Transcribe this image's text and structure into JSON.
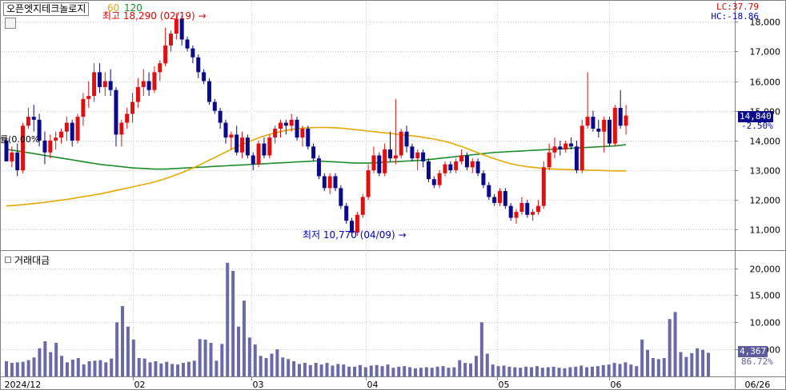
{
  "title": "오픈엣지테크놀로지",
  "ma": {
    "ma60_label": "60",
    "ma120_label": "120",
    "ma60_color": "#e6a800",
    "ma120_color": "#1a8c2a"
  },
  "indicator": {
    "lc": "LC:37.79",
    "hc": "HC:-18.86"
  },
  "left_clip": "률(0.00%",
  "annotations": {
    "high": {
      "text": "최고 18,290 (02/19)",
      "color": "#e00000"
    },
    "low": {
      "text": "최저 10,770 (04/09)",
      "color": "#0000c0"
    }
  },
  "volume_title": "거래대금",
  "current": {
    "price": "14,840",
    "change": "-2.50%",
    "volume": "4,367",
    "volume_pct": "86.72%"
  },
  "colors": {
    "up": "#e01010",
    "down": "#0a0a8a",
    "volume": "#6a6aa8",
    "grid": "#c8c8c8"
  },
  "chart_data": [
    {
      "type": "candlestick",
      "title": "오픈엣지테크놀로지",
      "x_tick_labels": [
        "2024/12",
        "02",
        "03",
        "04",
        "05",
        "06",
        "06/26"
      ],
      "y_tick_labels": [
        "18,000",
        "17,000",
        "16,000",
        "15,000",
        "14,000",
        "13,000",
        "12,000",
        "11,000"
      ],
      "ylim": [
        10500,
        18300
      ],
      "series_names": [
        "60",
        "120"
      ],
      "candles_ohlc": [
        [
          14000,
          14100,
          13300,
          13300
        ],
        [
          13300,
          13800,
          13100,
          13600
        ],
        [
          13600,
          13900,
          12800,
          13000
        ],
        [
          13000,
          14600,
          12900,
          14500
        ],
        [
          14500,
          15100,
          14400,
          14800
        ],
        [
          14800,
          15200,
          14300,
          14700
        ],
        [
          14700,
          14900,
          13800,
          14000
        ],
        [
          14000,
          14300,
          13200,
          13600
        ],
        [
          13600,
          14200,
          13400,
          14000
        ],
        [
          14000,
          14300,
          13700,
          14100
        ],
        [
          14100,
          14400,
          13900,
          14300
        ],
        [
          14300,
          14800,
          14000,
          14600
        ],
        [
          14600,
          14700,
          13800,
          14000
        ],
        [
          14000,
          14900,
          13900,
          14800
        ],
        [
          14800,
          15600,
          14500,
          15400
        ],
        [
          15400,
          16000,
          15100,
          15500
        ],
        [
          15500,
          16600,
          15300,
          16300
        ],
        [
          16300,
          16600,
          15600,
          15800
        ],
        [
          15800,
          16300,
          15500,
          16000
        ],
        [
          16000,
          16400,
          15500,
          15700
        ],
        [
          15700,
          15800,
          13800,
          14200
        ],
        [
          14200,
          14700,
          13800,
          14600
        ],
        [
          14600,
          15100,
          14400,
          14900
        ],
        [
          14900,
          15600,
          14600,
          15300
        ],
        [
          15300,
          16100,
          15100,
          15800
        ],
        [
          15800,
          16400,
          15500,
          16000
        ],
        [
          16000,
          16300,
          15500,
          15700
        ],
        [
          15700,
          16500,
          15600,
          16300
        ],
        [
          16300,
          16700,
          16000,
          16600
        ],
        [
          16600,
          17800,
          16500,
          17200
        ],
        [
          17200,
          17700,
          17000,
          17600
        ],
        [
          17600,
          18290,
          17400,
          18100
        ],
        [
          18100,
          18200,
          17200,
          17400
        ],
        [
          17400,
          17500,
          17000,
          17100
        ],
        [
          17100,
          17200,
          16600,
          16800
        ],
        [
          16800,
          16900,
          16100,
          16300
        ],
        [
          16300,
          16400,
          15900,
          16000
        ],
        [
          16000,
          16100,
          15200,
          15300
        ],
        [
          15300,
          15400,
          14900,
          15000
        ],
        [
          15000,
          15100,
          14400,
          14600
        ],
        [
          14600,
          14700,
          13900,
          14100
        ],
        [
          14100,
          14300,
          13700,
          14200
        ],
        [
          14200,
          14500,
          13500,
          13600
        ],
        [
          13600,
          14300,
          13400,
          14100
        ],
        [
          14100,
          14200,
          13400,
          13500
        ],
        [
          13500,
          13600,
          13000,
          13200
        ],
        [
          13200,
          14000,
          13100,
          13900
        ],
        [
          13900,
          14100,
          13400,
          13500
        ],
        [
          13500,
          14200,
          13400,
          14100
        ],
        [
          14100,
          14500,
          13900,
          14400
        ],
        [
          14400,
          14700,
          14100,
          14600
        ],
        [
          14600,
          14700,
          14200,
          14500
        ],
        [
          14500,
          14900,
          14300,
          14700
        ],
        [
          14700,
          14800,
          14000,
          14100
        ],
        [
          14100,
          14500,
          13800,
          14400
        ],
        [
          14400,
          14500,
          13700,
          13800
        ],
        [
          13800,
          13900,
          13300,
          13400
        ],
        [
          13400,
          13500,
          12700,
          12800
        ],
        [
          12800,
          12900,
          12300,
          12400
        ],
        [
          12400,
          12900,
          12200,
          12800
        ],
        [
          12800,
          12900,
          12300,
          12400
        ],
        [
          12400,
          12500,
          11700,
          11800
        ],
        [
          11800,
          11900,
          11200,
          11300
        ],
        [
          11300,
          11400,
          10770,
          10900
        ],
        [
          10900,
          11600,
          10800,
          11500
        ],
        [
          11500,
          12200,
          11400,
          12100
        ],
        [
          12100,
          13200,
          12000,
          13000
        ],
        [
          13000,
          13800,
          12900,
          13500
        ],
        [
          13500,
          13600,
          12800,
          12900
        ],
        [
          12900,
          13900,
          12800,
          13700
        ],
        [
          13700,
          14300,
          13300,
          13400
        ],
        [
          13400,
          15400,
          13200,
          13500
        ],
        [
          13500,
          14400,
          13400,
          14300
        ],
        [
          14300,
          14500,
          13600,
          13800
        ],
        [
          13800,
          13900,
          13300,
          13400
        ],
        [
          13400,
          13700,
          13000,
          13600
        ],
        [
          13600,
          13700,
          13100,
          13300
        ],
        [
          13300,
          13400,
          12600,
          12700
        ],
        [
          12700,
          12800,
          12400,
          12500
        ],
        [
          12500,
          13000,
          12400,
          12900
        ],
        [
          12900,
          13300,
          12800,
          13200
        ],
        [
          13200,
          13300,
          12900,
          13000
        ],
        [
          13000,
          13400,
          12900,
          13300
        ],
        [
          13300,
          13700,
          13200,
          13500
        ],
        [
          13500,
          13600,
          13000,
          13100
        ],
        [
          13100,
          13400,
          12900,
          13300
        ],
        [
          13300,
          13400,
          12800,
          12900
        ],
        [
          12900,
          13000,
          12400,
          12500
        ],
        [
          12500,
          12600,
          12000,
          12100
        ],
        [
          12100,
          12200,
          11800,
          11900
        ],
        [
          11900,
          12400,
          11800,
          12300
        ],
        [
          12300,
          12400,
          11700,
          11800
        ],
        [
          11800,
          11900,
          11300,
          11400
        ],
        [
          11400,
          11700,
          11200,
          11600
        ],
        [
          11600,
          12100,
          11500,
          11900
        ],
        [
          11900,
          12000,
          11400,
          11500
        ],
        [
          11500,
          11700,
          11300,
          11600
        ],
        [
          11600,
          12000,
          11500,
          11800
        ],
        [
          11800,
          13300,
          11700,
          13100
        ],
        [
          13100,
          13900,
          13000,
          13600
        ],
        [
          13600,
          14100,
          13400,
          13800
        ],
        [
          13800,
          14000,
          13500,
          13700
        ],
        [
          13700,
          14000,
          13600,
          13900
        ],
        [
          13900,
          14100,
          13700,
          13800
        ],
        [
          13800,
          14000,
          12900,
          13000
        ],
        [
          13000,
          14700,
          12900,
          14500
        ],
        [
          14500,
          16300,
          14400,
          14800
        ],
        [
          14800,
          15000,
          14300,
          14400
        ],
        [
          14400,
          14700,
          14100,
          14300
        ],
        [
          14300,
          14800,
          13600,
          14700
        ],
        [
          14700,
          14800,
          13800,
          13900
        ],
        [
          13900,
          15200,
          13800,
          15100
        ],
        [
          15100,
          15700,
          14400,
          14500
        ],
        [
          14500,
          15200,
          14200,
          14840
        ]
      ],
      "ma60_values": [
        11800,
        11810,
        11825,
        11840,
        11860,
        11880,
        11900,
        11920,
        11945,
        11970,
        11995,
        12020,
        12050,
        12080,
        12110,
        12140,
        12170,
        12200,
        12240,
        12280,
        12320,
        12360,
        12400,
        12440,
        12480,
        12520,
        12560,
        12610,
        12660,
        12720,
        12780,
        12850,
        12920,
        13000,
        13080,
        13160,
        13250,
        13340,
        13430,
        13520,
        13610,
        13700,
        13790,
        13870,
        13950,
        14020,
        14090,
        14150,
        14210,
        14260,
        14300,
        14340,
        14370,
        14400,
        14420,
        14430,
        14435,
        14440,
        14440,
        14435,
        14430,
        14420,
        14400,
        14380,
        14360,
        14340,
        14320,
        14300,
        14280,
        14260,
        14240,
        14220,
        14200,
        14180,
        14160,
        14140,
        14110,
        14080,
        14050,
        14010,
        13970,
        13920,
        13860,
        13800,
        13730,
        13660,
        13590,
        13520,
        13450,
        13390,
        13330,
        13270,
        13220,
        13180,
        13150,
        13120,
        13100,
        13080,
        13060,
        13050,
        13040,
        13030,
        13025,
        13020,
        13015,
        13010,
        13005,
        13000,
        12995,
        12990,
        12985,
        12980,
        12980,
        12980
      ],
      "ma120_values": [
        13700,
        13680,
        13650,
        13620,
        13590,
        13560,
        13530,
        13500,
        13470,
        13440,
        13410,
        13380,
        13350,
        13320,
        13290,
        13260,
        13230,
        13200,
        13180,
        13160,
        13140,
        13120,
        13100,
        13080,
        13070,
        13060,
        13050,
        13040,
        13040,
        13040,
        13050,
        13060,
        13070,
        13080,
        13090,
        13100,
        13110,
        13120,
        13130,
        13140,
        13150,
        13160,
        13170,
        13180,
        13190,
        13200,
        13210,
        13220,
        13230,
        13240,
        13250,
        13260,
        13270,
        13280,
        13290,
        13300,
        13310,
        13310,
        13300,
        13290,
        13280,
        13270,
        13260,
        13250,
        13240,
        13240,
        13240,
        13250,
        13260,
        13270,
        13280,
        13290,
        13300,
        13310,
        13320,
        13330,
        13340,
        13360,
        13380,
        13400,
        13420,
        13440,
        13460,
        13480,
        13500,
        13520,
        13540,
        13560,
        13580,
        13600,
        13610,
        13620,
        13630,
        13640,
        13650,
        13660,
        13670,
        13680,
        13690,
        13700,
        13710,
        13720,
        13730,
        13740,
        13750,
        13760,
        13770,
        13780,
        13790,
        13800,
        13810,
        13820,
        13840,
        13860
      ]
    },
    {
      "type": "bar",
      "title": "거래대금",
      "y_tick_labels": [
        "20,000",
        "15,000",
        "10,000",
        "5,000"
      ],
      "ylim": [
        0,
        22000
      ],
      "values": [
        2800,
        2500,
        2600,
        2700,
        3000,
        3500,
        5200,
        6500,
        4500,
        6200,
        3800,
        2600,
        3100,
        3400,
        2200,
        2800,
        2900,
        3000,
        2600,
        3300,
        10000,
        13000,
        9200,
        6800,
        3400,
        3300,
        2600,
        2800,
        2400,
        2700,
        2300,
        2200,
        2500,
        2700,
        2900,
        6900,
        6800,
        6200,
        2900,
        6000,
        21000,
        19500,
        9200,
        14000,
        7200,
        5900,
        3800,
        3400,
        4200,
        5000,
        3500,
        3200,
        2800,
        2300,
        2500,
        2100,
        2500,
        2200,
        2500,
        2000,
        2300,
        2200,
        1800,
        1800,
        2100,
        1700,
        2000,
        2100,
        1900,
        2200,
        1600,
        1800,
        1900,
        1700,
        1500,
        1600,
        1700,
        1600,
        1800,
        1900,
        1600,
        1700,
        3000,
        2500,
        2400,
        3800,
        10000,
        4200,
        2200,
        1900,
        2000,
        1800,
        1700,
        1600,
        1800,
        1700,
        1900,
        1600,
        1700,
        1800,
        1600,
        1500,
        1700,
        1800,
        2000,
        1700,
        1800,
        1900,
        2100,
        2200,
        2500,
        2300,
        2600,
        2200,
        1900,
        6800,
        4900,
        3400,
        3200,
        3400,
        10600,
        11900,
        4500,
        3600,
        4300,
        5200,
        4900,
        4367
      ]
    }
  ]
}
